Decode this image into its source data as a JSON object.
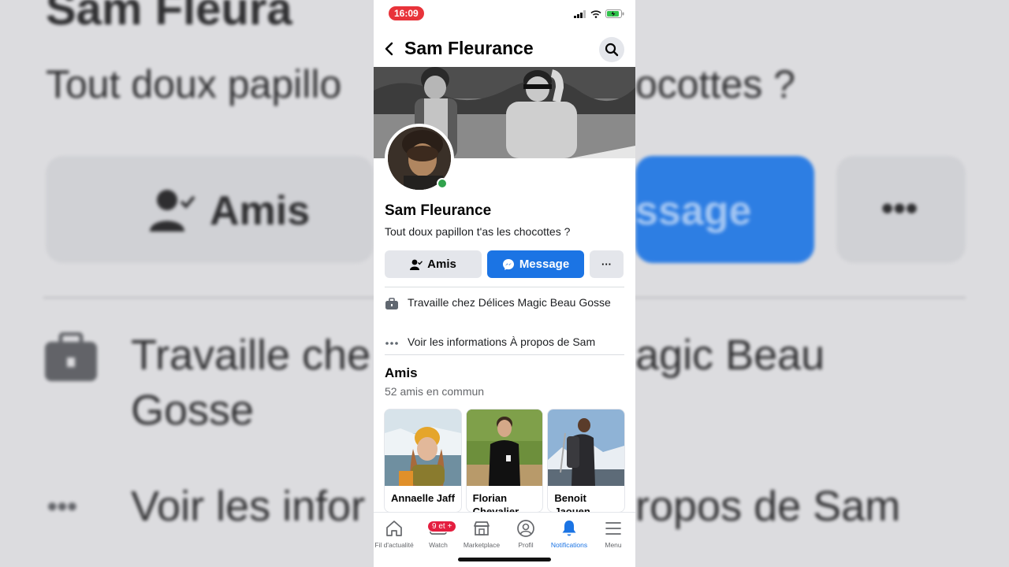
{
  "status": {
    "time": "16:09"
  },
  "header": {
    "title": "Sam Fleurance"
  },
  "profile": {
    "name": "Sam Fleurance",
    "bio": "Tout doux papillon t'as les chocottes ?"
  },
  "actions": {
    "friends_label": "Amis",
    "message_label": "Message",
    "more_label": "···"
  },
  "info": {
    "work": "Travaille chez Délices Magic Beau Gosse",
    "about": "Voir les informations À propos de Sam"
  },
  "friends": {
    "title": "Amis",
    "mutual": "52 amis en commun",
    "cards": [
      {
        "name": "Annaelle Jaff"
      },
      {
        "name": "Florian Chevalier"
      },
      {
        "name": "Benoit Jaouen"
      }
    ]
  },
  "tabs": [
    {
      "label": "Fil d'actualité",
      "icon": "home-icon"
    },
    {
      "label": "Watch",
      "icon": "watch-icon",
      "badge": "9 et +"
    },
    {
      "label": "Marketplace",
      "icon": "marketplace-icon"
    },
    {
      "label": "Profil",
      "icon": "profile-icon"
    },
    {
      "label": "Notifications",
      "icon": "bell-icon",
      "active": true
    },
    {
      "label": "Menu",
      "icon": "menu-icon"
    }
  ],
  "background": {
    "name_fragment": "Sam Fleura",
    "bio_left": "Tout doux papillo",
    "bio_right": "ocottes ?",
    "amis": "Amis",
    "message_fragment": "ssage",
    "work_left": "Travaille che",
    "work_right": "agic Beau",
    "work_line2": "Gosse",
    "about_left": "Voir les infor",
    "about_right": "ropos de Sam"
  },
  "colors": {
    "accent": "#1b74e4",
    "badge": "#e41e3f",
    "online": "#31a24c"
  }
}
